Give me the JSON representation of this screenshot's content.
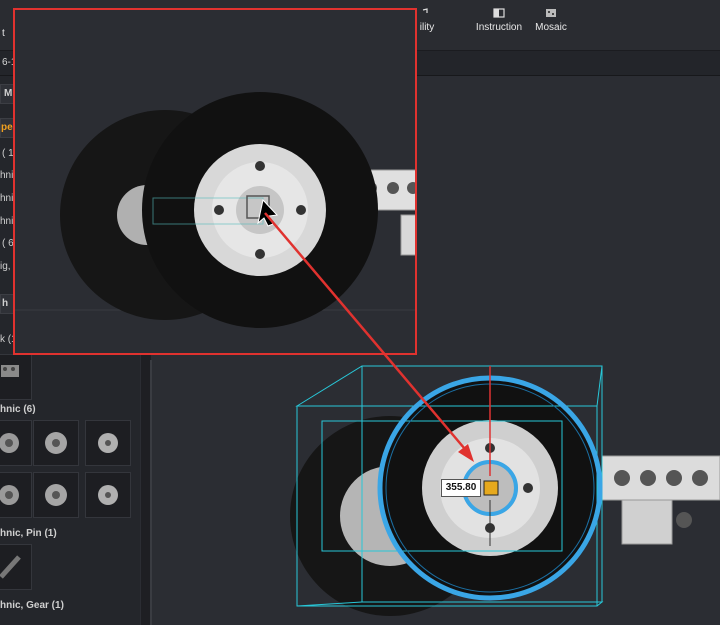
{
  "toolbar": {
    "items": [
      {
        "label": "ility",
        "icon": "stability-icon"
      },
      {
        "label": "Instruction",
        "icon": "instruction-icon"
      },
      {
        "label": "Mosaic",
        "icon": "mosaic-icon"
      }
    ],
    "left_fragment": "t"
  },
  "subbar": {
    "left_fragment": "6-1"
  },
  "sidebar": {
    "fragments": [
      "M",
      "pe",
      "( 1",
      "hnic",
      "hnic",
      "hnic",
      "( 6",
      "ig,",
      "h",
      "k (1"
    ],
    "groups": [
      {
        "label": "hnic (6)"
      },
      {
        "label": "hnic, Pin (1)"
      },
      {
        "label": "hnic, Gear (1)"
      }
    ]
  },
  "viewport": {
    "rotation_angle": "355.80"
  },
  "colors": {
    "accent": "#e0322f",
    "rotation_ring": "#3aa6e6",
    "bbox": "#28c7d8"
  }
}
